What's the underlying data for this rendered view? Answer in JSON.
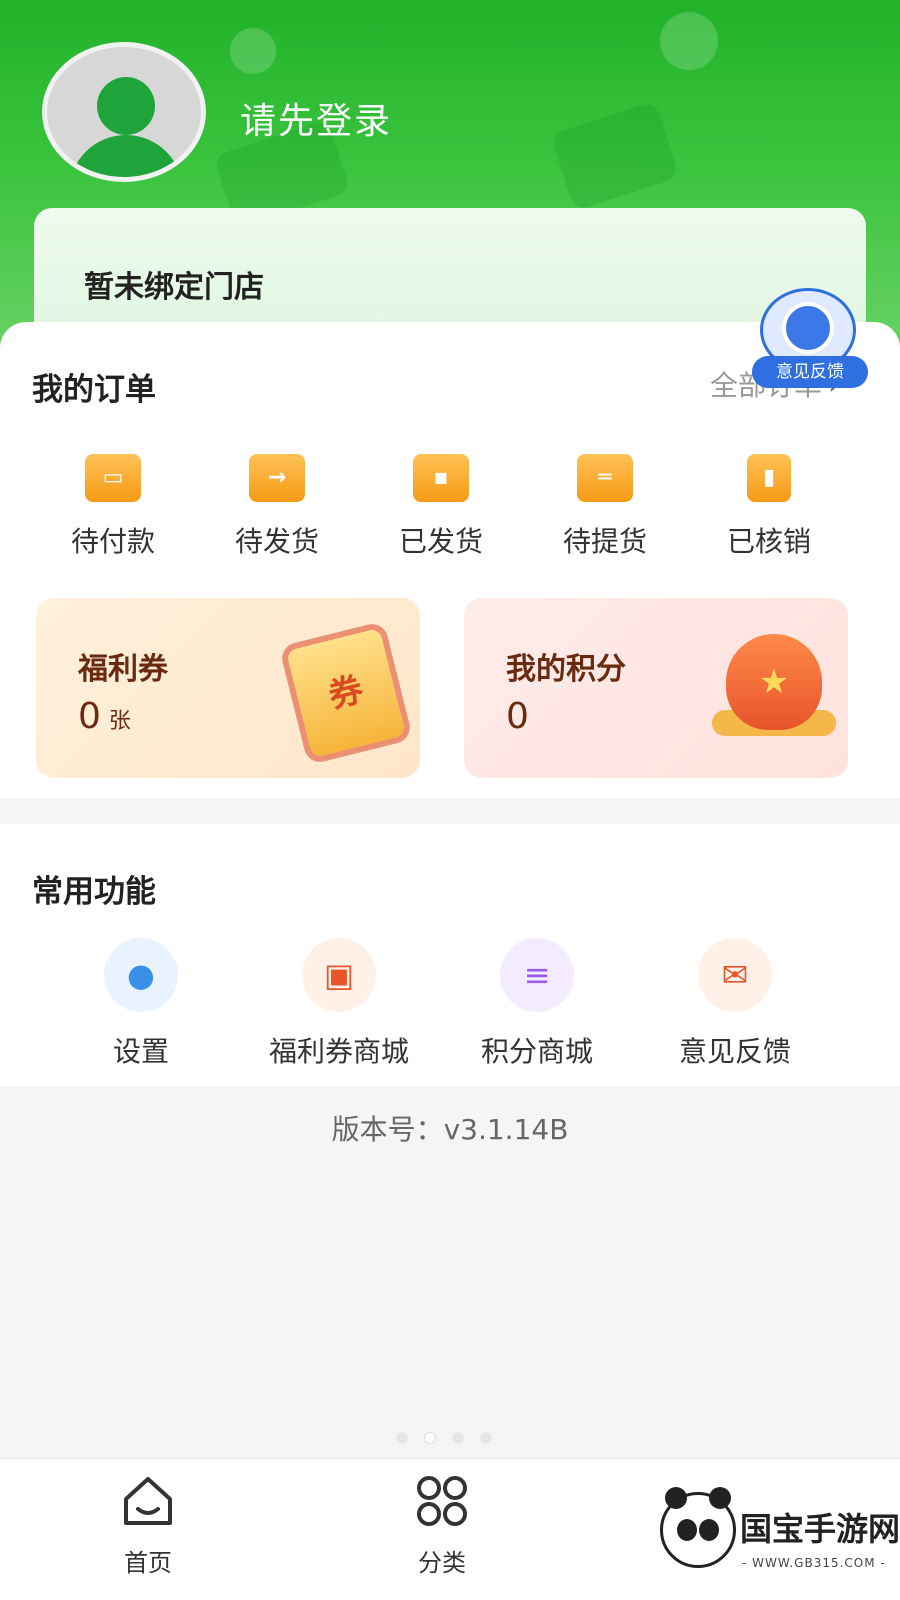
{
  "header": {
    "login_prompt": "请先登录",
    "store_status": "暂未绑定门店"
  },
  "feedback_float": {
    "label": "意见反馈"
  },
  "orders": {
    "title": "我的订单",
    "all_link": "全部订单",
    "items": [
      {
        "label": "待付款",
        "icon": "wallet-icon"
      },
      {
        "label": "待发货",
        "icon": "shipping-box-icon"
      },
      {
        "label": "已发货",
        "icon": "truck-icon"
      },
      {
        "label": "待提货",
        "icon": "pickup-box-icon"
      },
      {
        "label": "已核销",
        "icon": "verified-book-icon"
      }
    ]
  },
  "promo": {
    "coupon": {
      "title": "福利券",
      "value": "0",
      "unit": "张",
      "art_text": "券"
    },
    "points": {
      "title": "我的积分",
      "value": "0"
    }
  },
  "functions": {
    "title": "常用功能",
    "items": [
      {
        "label": "设置",
        "icon": "user-settings-icon",
        "color": "#3a8fe8",
        "bg": "#e9f3ff"
      },
      {
        "label": "福利券商城",
        "icon": "gift-icon",
        "color": "#e8552a",
        "bg": "#fff0e8"
      },
      {
        "label": "积分商城",
        "icon": "coin-stack-icon",
        "color": "#9a5ce6",
        "bg": "#f3ebff"
      },
      {
        "label": "意见反馈",
        "icon": "mail-icon",
        "color": "#e8552a",
        "bg": "#fff0e8"
      }
    ]
  },
  "version": "版本号：v3.1.14B",
  "tabbar": {
    "home": "首页",
    "category": "分类"
  },
  "watermark": {
    "brand": "国宝手游网",
    "url": "- WWW.GB315.COM -"
  },
  "colors": {
    "brand_green": "#21b22a",
    "accent_orange": "#f59a16",
    "feedback_blue": "#2f6fe0"
  }
}
